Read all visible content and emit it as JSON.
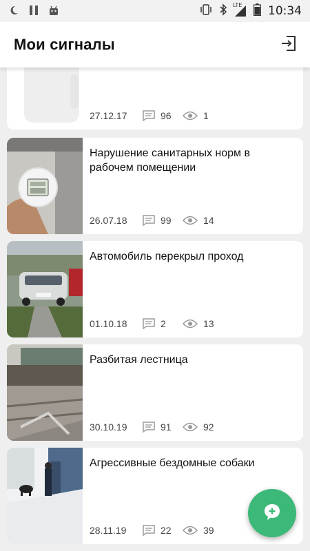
{
  "status_bar": {
    "time": "10:34",
    "network": "LTE",
    "icons": [
      "moon-icon",
      "pause-icon",
      "android-icon",
      "vibrate-icon",
      "bluetooth-icon",
      "signal-icon",
      "battery-icon"
    ]
  },
  "header": {
    "title": "Мои сигналы",
    "logout_icon": "logout-icon"
  },
  "colors": {
    "accent": "#3cb878",
    "background": "#efefef",
    "card": "#ffffff",
    "meta_icon": "#9a9a9a"
  },
  "signals": [
    {
      "title": "",
      "date": "27.12.17",
      "comments": "96",
      "views": "1"
    },
    {
      "title": "Нарушение санитарных норм в рабочем помещении",
      "date": "26.07.18",
      "comments": "99",
      "views": "14"
    },
    {
      "title": "Автомобиль перекрыл проход",
      "date": "01.10.18",
      "comments": "2",
      "views": "13"
    },
    {
      "title": "Разбитая лестница",
      "date": "30.10.19",
      "comments": "91",
      "views": "92"
    },
    {
      "title": "Агрессивные бездомные собаки",
      "date": "28.11.19",
      "comments": "22",
      "views": "39"
    }
  ],
  "fab": {
    "icon": "add-comment-icon"
  }
}
